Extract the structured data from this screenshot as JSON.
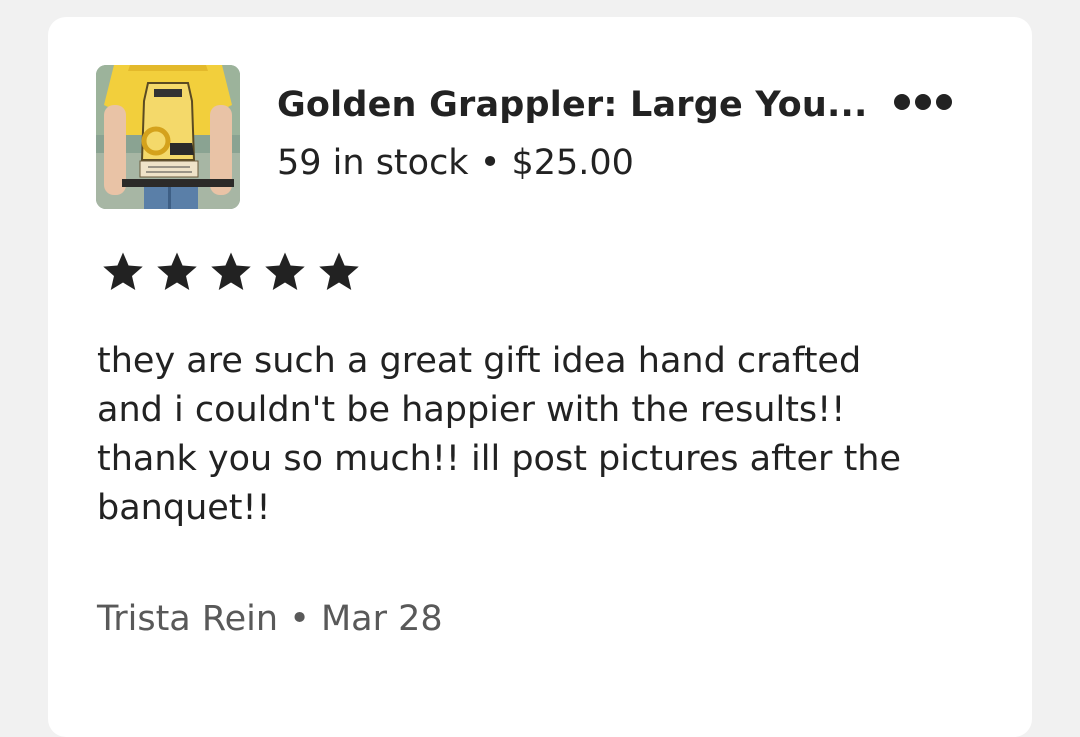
{
  "listing": {
    "title": "Golden Grappler: Large You...",
    "stock_price": "59 in stock • $25.00",
    "image_alt": "wrestling trophy product photo"
  },
  "menu": {
    "icon": "more-horizontal-icon"
  },
  "review": {
    "rating": 5,
    "rating_max": 5,
    "lines": [
      "they are such a great gift idea hand crafted",
      "and i couldn't be happier with the results!!",
      "thank you so much!! ill post pictures after the",
      "banquet!!"
    ],
    "byline": "Trista Rein • Mar 28"
  },
  "colors": {
    "background": "#f1f1f1",
    "card": "#ffffff",
    "text": "#222222",
    "muted_text": "#595959"
  }
}
